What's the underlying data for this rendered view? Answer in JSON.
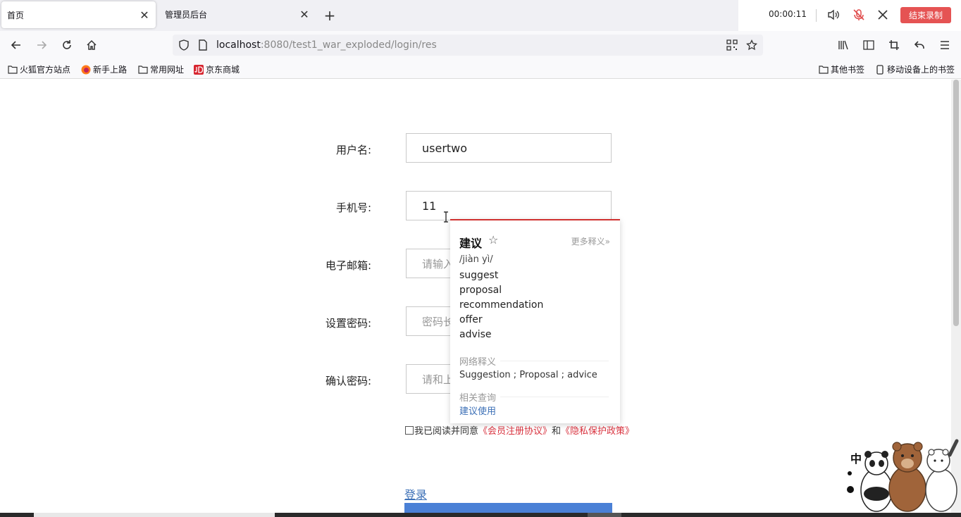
{
  "browser": {
    "tabs": [
      {
        "title": "首页",
        "active": true
      },
      {
        "title": "管理员后台",
        "active": false
      }
    ],
    "recorder": {
      "time": "00:00:11",
      "stop_label": "结束录制"
    },
    "url": {
      "host": "localhost",
      "rest": ":8080/test1_war_exploded/login/res"
    },
    "bookmarks": [
      "火狐官方站点",
      "新手上路",
      "常用网址",
      "京东商城"
    ],
    "bookmarks_right": [
      "其他书签",
      "移动设备上的书签"
    ]
  },
  "form": {
    "username": {
      "label": "用户名:",
      "value": "usertwo"
    },
    "phone": {
      "label": "手机号:",
      "value": "11"
    },
    "email": {
      "label": "电子邮箱:",
      "placeholder": "请输入"
    },
    "password": {
      "label": "设置密码:",
      "placeholder": "密码长"
    },
    "confirm": {
      "label": "确认密码:",
      "placeholder": "请和上"
    },
    "agree_text": "我已阅读并同意",
    "agree_link1": "《会员注册协议》",
    "agree_and": "和",
    "agree_link2": "《隐私保护政策》",
    "login_link": "登录"
  },
  "dictionary_popup": {
    "word": "建议",
    "more": "更多释义»",
    "phonetic": "/jiàn yì/",
    "definitions": [
      "suggest",
      "proposal",
      "recommendation",
      "offer",
      "advise"
    ],
    "web_section": "网络释义",
    "web_definition": "Suggestion ; Proposal ; advice",
    "related_section": "相关查询",
    "related_item": "建议使用"
  },
  "mascot": {
    "badge": "中"
  }
}
